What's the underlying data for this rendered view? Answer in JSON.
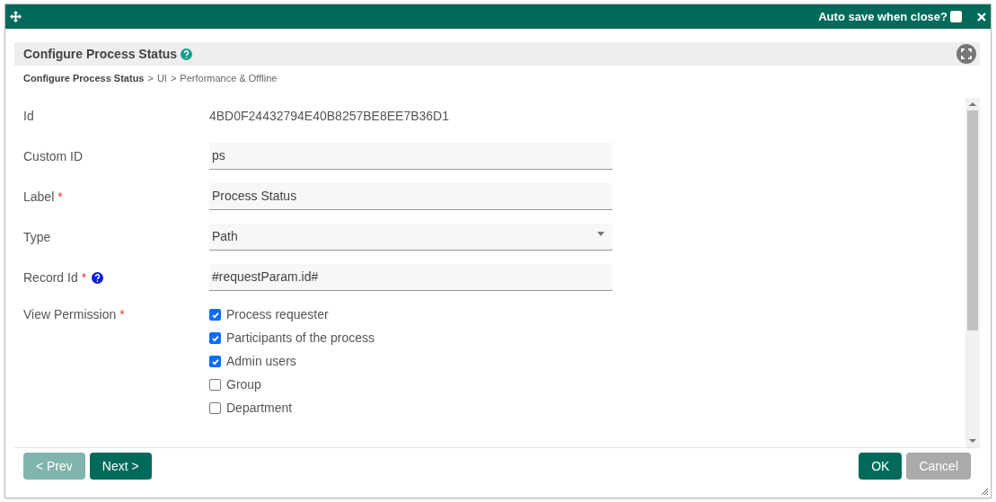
{
  "header": {
    "auto_save": {
      "label": "Auto save when close?",
      "checked": false
    }
  },
  "panel": {
    "title": "Configure Process Status",
    "breadcrumb": [
      {
        "text": "Configure Process Status",
        "current": true
      },
      {
        "separator": ">",
        "text": "UI",
        "current": false
      },
      {
        "separator": ">",
        "text": "Performance & Offline",
        "current": false
      }
    ]
  },
  "fields": [
    {
      "kind": "text",
      "label": "Id",
      "help": false,
      "value": "4BD0F24432794E40B8257BE8EE7B36D1"
    },
    {
      "kind": "input",
      "label": "Custom ID",
      "help": false,
      "value": "ps"
    },
    {
      "kind": "input",
      "label": "Label",
      "required_mark": "*",
      "help": false,
      "value": "Process Status"
    },
    {
      "kind": "select",
      "label": "Type",
      "help": false,
      "value": "Path"
    },
    {
      "kind": "input",
      "label": "Record Id",
      "required_mark": "*",
      "help": true,
      "value": "#requestParam.id#"
    },
    {
      "kind": "checkboxes",
      "label": "View Permission",
      "required_mark": "*",
      "help": false,
      "options": [
        {
          "label": "Process requester",
          "checked": true
        },
        {
          "label": "Participants of the process",
          "checked": true
        },
        {
          "label": "Admin users",
          "checked": true
        },
        {
          "label": "Group",
          "checked": false
        },
        {
          "label": "Department",
          "checked": false
        }
      ]
    }
  ],
  "buttons_left": [
    {
      "label": "< Prev",
      "disabled": true
    },
    {
      "label": "Next >",
      "disabled": false
    }
  ],
  "buttons_right": [
    {
      "label": "OK",
      "disabled": false
    },
    {
      "label": "Cancel",
      "disabled": true
    }
  ]
}
